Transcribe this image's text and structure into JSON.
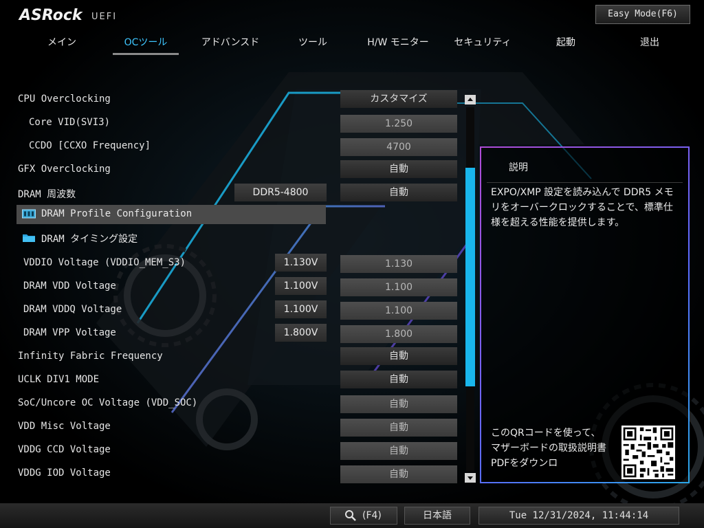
{
  "header": {
    "logo": "ASRock",
    "logo_sub": "UEFI",
    "easy_mode_label": "Easy Mode(F6)"
  },
  "tabs": [
    {
      "label": "メイン"
    },
    {
      "label": "OCツール",
      "active": true
    },
    {
      "label": "アドバンスド"
    },
    {
      "label": "ツール"
    },
    {
      "label": "H/W モニター"
    },
    {
      "label": "セキュリティ"
    },
    {
      "label": "起動"
    },
    {
      "label": "退出"
    }
  ],
  "rows": {
    "cpu_oc": {
      "label": "CPU Overclocking",
      "value": "カスタマイズ"
    },
    "core_vid": {
      "label": "Core VID(SVI3)",
      "value": "1.250"
    },
    "ccdo": {
      "label": "CCDO [CCXO Frequency]",
      "value": "4700"
    },
    "gfx_oc": {
      "label": "GFX Overclocking",
      "value": "自動"
    },
    "dram_freq": {
      "label": "DRAM 周波数",
      "current": "DDR5-4800",
      "value": "自動"
    },
    "dram_profile": {
      "label": "DRAM Profile Configuration"
    },
    "dram_timing": {
      "label": "DRAM タイミング設定"
    },
    "vddio": {
      "label": "VDDIO Voltage (VDDIO_MEM_S3)",
      "current": "1.130V",
      "value": "1.130"
    },
    "dram_vdd": {
      "label": "DRAM VDD Voltage",
      "current": "1.100V",
      "value": "1.100"
    },
    "dram_vddq": {
      "label": "DRAM VDDQ Voltage",
      "current": "1.100V",
      "value": "1.100"
    },
    "dram_vpp": {
      "label": "DRAM VPP Voltage",
      "current": "1.800V",
      "value": "1.800"
    },
    "infinity_fabric": {
      "label": "Infinity Fabric Frequency",
      "value": "自動"
    },
    "uclk": {
      "label": "UCLK DIV1 MODE",
      "value": "自動"
    },
    "soc_voltage": {
      "label": "SoC/Uncore OC Voltage (VDD_SOC)",
      "value": "自動"
    },
    "vdd_misc": {
      "label": "VDD Misc Voltage",
      "value": "自動"
    },
    "vddg_ccd": {
      "label": "VDDG CCD Voltage",
      "value": "自動"
    },
    "vddg_iod": {
      "label": "VDDG IOD Voltage",
      "value": "自動"
    }
  },
  "help": {
    "title": "説明",
    "text": "EXPO/XMP 設定を読み込んで DDR5 メモリをオーバークロックすることで、標準仕様を超える性能を提供します。",
    "qr_text": "このQRコードを使って、マザーボードの取扱説明書PDFをダウンロ"
  },
  "footer": {
    "search_label": "(F4)",
    "language": "日本語",
    "datetime": "Tue 12/31/2024, 11:44:14"
  },
  "icons": {
    "search": "search-icon",
    "profile": "memory-module-icon",
    "folder": "folder-icon",
    "scroll_up": "arrow-up-icon",
    "scroll_down": "arrow-down-icon",
    "qr": "qr-code-icon"
  },
  "colors": {
    "accent": "#3ec6ff",
    "scrollbar": "#19b6ec",
    "help_border_start": "#b04bd6",
    "help_border_end": "#2aa7e8"
  }
}
